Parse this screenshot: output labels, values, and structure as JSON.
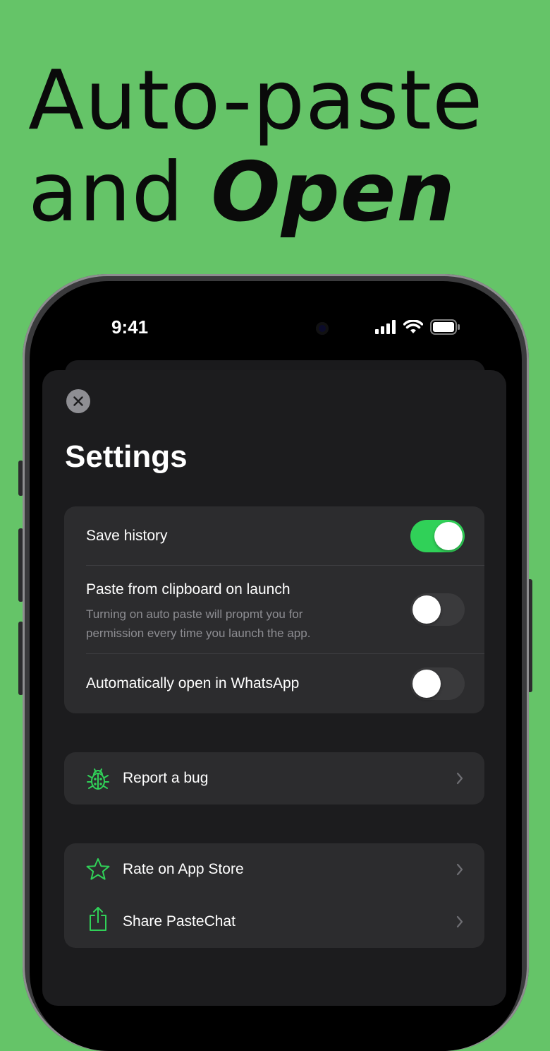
{
  "headline": {
    "line1": "Auto-paste",
    "line2_plain": "and ",
    "line2_emphasis": "Open"
  },
  "status_bar": {
    "time": "9:41",
    "icons": [
      "signal-icon",
      "wifi-icon",
      "battery-icon"
    ]
  },
  "settings": {
    "title": "Settings",
    "toggles": [
      {
        "label": "Save history",
        "on": true
      },
      {
        "label": "Paste from clipboard on launch",
        "sub_line1": "Turning on auto paste will propmt you for",
        "sub_line2": "permission every time you launch the app.",
        "on": false
      },
      {
        "label": "Automatically open in WhatsApp",
        "on": false
      }
    ],
    "report": {
      "label": "Report a bug",
      "icon": "bug-icon"
    },
    "links": [
      {
        "label": "Rate on App Store",
        "icon": "star-icon"
      },
      {
        "label": "Share PasteChat",
        "icon": "share-icon"
      }
    ]
  },
  "colors": {
    "background": "#65c468",
    "accent": "#30d158",
    "sheet": "#1c1c1e",
    "cell": "#2c2c2e"
  }
}
